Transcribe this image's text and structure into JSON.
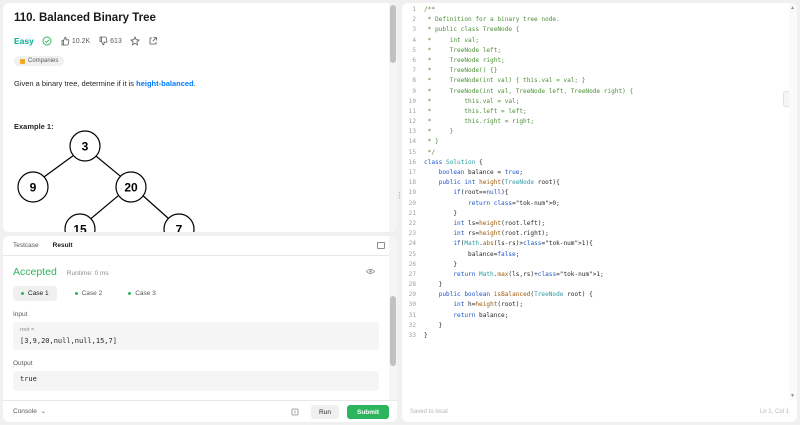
{
  "problem": {
    "title": "110. Balanced Binary Tree",
    "difficulty": "Easy",
    "likes": "10.2K",
    "dislikes": "613",
    "companies_label": "Companies",
    "description_prefix": "Given a binary tree, determine if it is ",
    "description_highlight": "height-balanced",
    "description_suffix": ".",
    "example_title": "Example 1:",
    "tree_nodes": [
      "3",
      "9",
      "20",
      "15",
      "7"
    ]
  },
  "result": {
    "tabs": [
      "Testcase",
      "Result"
    ],
    "status": "Accepted",
    "runtime": "Runtime: 0 ms",
    "cases": [
      "Case 1",
      "Case 2",
      "Case 3"
    ],
    "input_label": "Input",
    "param_name": "root =",
    "input_value": "[3,9,20,null,null,15,7]",
    "output_label": "Output",
    "output_value": "true"
  },
  "footer": {
    "console_label": "Console",
    "run_label": "Run",
    "submit_label": "Submit"
  },
  "editor": {
    "saved_status": "Saved to local",
    "cursor_pos": "Ln 1, Col 1",
    "lines": [
      "/**",
      " * Definition for a binary tree node.",
      " * public class TreeNode {",
      " *     int val;",
      " *     TreeNode left;",
      " *     TreeNode right;",
      " *     TreeNode() {}",
      " *     TreeNode(int val) { this.val = val; }",
      " *     TreeNode(int val, TreeNode left, TreeNode right) {",
      " *         this.val = val;",
      " *         this.left = left;",
      " *         this.right = right;",
      " *     }",
      " * }",
      " */",
      "class Solution {",
      "    boolean balance = true;",
      "    public int height(TreeNode root){",
      "        if(root==null){",
      "            return 0;",
      "        }",
      "        int ls=height(root.left);",
      "        int rs=height(root.right);",
      "        if(Math.abs(ls-rs)>1){",
      "            balance=false;",
      "        }",
      "        return Math.max(ls,rs)+1;",
      "    }",
      "    public boolean isBalanced(TreeNode root) {",
      "        int h=height(root);",
      "        return balance;",
      "    }",
      "}"
    ]
  },
  "colors": {
    "accent_green": "#2db55d",
    "easy_teal": "#00af9b",
    "link_blue": "#007aff"
  }
}
